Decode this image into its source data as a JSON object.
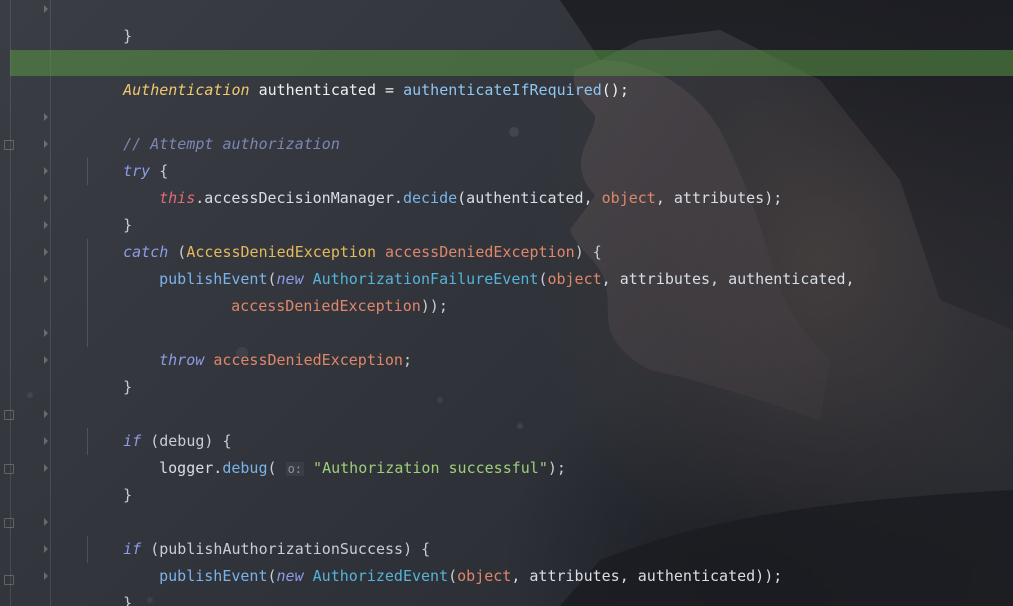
{
  "editor": {
    "language": "java",
    "highlighted_line_index": 1,
    "colors": {
      "highlight": "#5a9646",
      "keyword_italic": "#8e9be8",
      "type": "#e5b95c",
      "method": "#7ab3ea",
      "param": "#e0866a",
      "this_keyword": "#e06a7a",
      "comment": "#7d86b2",
      "string": "#9fce7a"
    }
  },
  "code": {
    "l1": {
      "brace": "}"
    },
    "l2": {
      "type": "Authentication",
      "name": " authenticated = ",
      "call": "authenticateIfRequired",
      "end": "();"
    },
    "l3": {
      "comment": "// Attempt authorization"
    },
    "l4": {
      "kw": "try",
      "rest": " {"
    },
    "l5": {
      "this": "this",
      "dot": ".accessDecisionManager.",
      "method": "decide",
      "open": "(authenticated, ",
      "obj": "object",
      "rest": ", attributes);"
    },
    "l6": {
      "brace": "}"
    },
    "l7": {
      "kw": "catch",
      "open": " (",
      "type": "AccessDeniedException",
      "sp": " ",
      "param": "accessDeniedException",
      "rest": ") {"
    },
    "l8": {
      "method": "publishEvent",
      "open": "(",
      "kw": "new",
      "sp": " ",
      "cls": "AuthorizationFailureEvent",
      "open2": "(",
      "obj": "object",
      "rest": ", attributes, authenticated,"
    },
    "l9": {
      "param": "accessDeniedException",
      "rest": "));"
    },
    "l10": {
      "kw": "throw",
      "sp": " ",
      "param": "accessDeniedException",
      "rest": ";"
    },
    "l11": {
      "brace": "}"
    },
    "l12": {
      "kw": "if",
      "rest": " (debug) {"
    },
    "l13": {
      "var": "logger.",
      "method": "debug",
      "open": "( ",
      "hint": "o:",
      "sp": " ",
      "str": "\"Authorization successful\"",
      "rest": ");"
    },
    "l14": {
      "brace": "}"
    },
    "l15": {
      "kw": "if",
      "rest": " (publishAuthorizationSuccess) {"
    },
    "l16": {
      "method": "publishEvent",
      "open": "(",
      "kw": "new",
      "sp": " ",
      "cls": "AuthorizedEvent",
      "open2": "(",
      "obj": "object",
      "rest": ", attributes, authenticated));"
    },
    "l17": {
      "brace": "}"
    }
  }
}
